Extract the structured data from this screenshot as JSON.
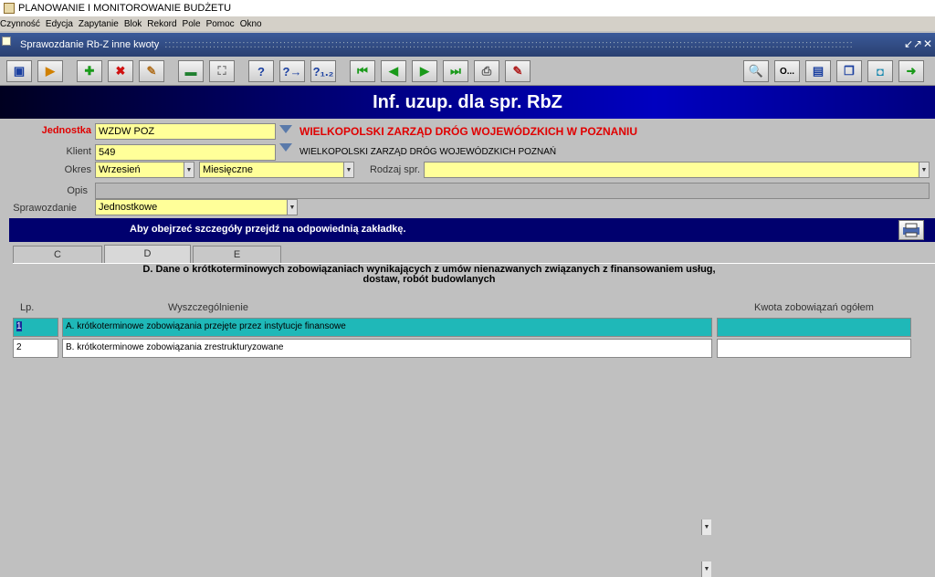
{
  "app": {
    "title": "PLANOWANIE I MONITOROWANIE BUDŻETU"
  },
  "menu": [
    "Czynność",
    "Edycja",
    "Zapytanie",
    "Blok",
    "Rekord",
    "Pole",
    "Pomoc",
    "Okno"
  ],
  "window": {
    "title": "Sprawozdanie Rb-Z inne kwoty",
    "controls": [
      "↙",
      "↗",
      "✕"
    ]
  },
  "toolbar": {
    "left_buttons": [
      {
        "name": "save-icon",
        "glyph": "▣",
        "color": "#1a3fa0"
      },
      {
        "name": "exit-icon",
        "glyph": "▶",
        "color": "#d08000"
      },
      {
        "name": "insert-record-icon",
        "glyph": "✚",
        "color": "#1a9a1a"
      },
      {
        "name": "delete-record-icon",
        "glyph": "✖",
        "color": "#d01010"
      },
      {
        "name": "clear-record-icon",
        "glyph": "✎",
        "color": "#b07020"
      },
      {
        "name": "duplicate-icon",
        "glyph": "▬",
        "color": "#208030"
      },
      {
        "name": "expand-icon",
        "glyph": "⛶",
        "color": "#777"
      },
      {
        "name": "query-icon",
        "glyph": "?",
        "color": "#1a3fa0"
      },
      {
        "name": "query-execute-icon",
        "glyph": "?→",
        "color": "#1a3fa0"
      },
      {
        "name": "query-count-icon",
        "glyph": "?₁.₂",
        "color": "#1a3fa0"
      },
      {
        "name": "first-record-icon",
        "glyph": "⏮",
        "color": "#1a9a1a"
      },
      {
        "name": "prev-record-icon",
        "glyph": "◀",
        "color": "#1a9a1a"
      },
      {
        "name": "next-record-icon",
        "glyph": "▶",
        "color": "#1a9a1a"
      },
      {
        "name": "last-record-icon",
        "glyph": "⏭",
        "color": "#1a9a1a"
      },
      {
        "name": "print-icon",
        "glyph": "⎙",
        "color": "#555"
      },
      {
        "name": "edit-icon",
        "glyph": "✎",
        "color": "#b02020"
      }
    ],
    "right_buttons": [
      {
        "name": "search-icon",
        "glyph": "🔍",
        "color": "#444"
      },
      {
        "name": "options-button",
        "glyph": "O...",
        "color": "#000"
      },
      {
        "name": "document-icon",
        "glyph": "▤",
        "color": "#1a3fa0"
      },
      {
        "name": "windows-icon",
        "glyph": "❐",
        "color": "#1a3fa0"
      },
      {
        "name": "calendar-icon",
        "glyph": "◘",
        "color": "#1a8ab0"
      },
      {
        "name": "logout-icon",
        "glyph": "➜",
        "color": "#1a9a1a"
      }
    ]
  },
  "banner": {
    "title": "Inf. uzup. dla spr. RbZ"
  },
  "form": {
    "jednostka": {
      "label": "Jednostka",
      "value": "WZDW POZ",
      "description": "WIELKOPOLSKI ZARZĄD DRÓG WOJEWÓDZKICH W POZNANIU"
    },
    "klient": {
      "label": "Klient",
      "value": "549",
      "description": "WIELKOPOLSKI ZARZĄD DRÓG WOJEWÓDZKICH POZNAŃ"
    },
    "okres": {
      "label": "Okres",
      "month": "Wrzesień",
      "period_type": "Miesięczne"
    },
    "rodzaj": {
      "label": "Rodzaj spr.",
      "value": ""
    },
    "opis": {
      "label": "Opis",
      "value": ""
    },
    "sprawozdanie": {
      "label": "Sprawozdanie",
      "value": "Jednostkowe"
    }
  },
  "info_bar": {
    "message": "Aby obejrzeć szczegóły przejdź na odpowiednią zakładkę."
  },
  "tabs": [
    {
      "label": "C"
    },
    {
      "label": "D"
    },
    {
      "label": "E"
    }
  ],
  "active_tab": "D",
  "section": {
    "title_line1": "D. Dane o krótkoterminowych zobowiązaniach wynikających z umów nienazwanych związanych z finansowaniem usług,",
    "title_line2": "dostaw, robót budowlanych"
  },
  "table": {
    "columns": {
      "lp": "Lp.",
      "desc": "Wyszczególnienie",
      "amount": "Kwota zobowiązań ogółem"
    },
    "rows": [
      {
        "lp": "1",
        "desc": "A. krótkoterminowe zobowiązania przejęte przez instytucje finansowe",
        "amount": ""
      },
      {
        "lp": "2",
        "desc": "B. krótkoterminowe zobowiązania zrestrukturyzowane",
        "amount": ""
      }
    ]
  }
}
